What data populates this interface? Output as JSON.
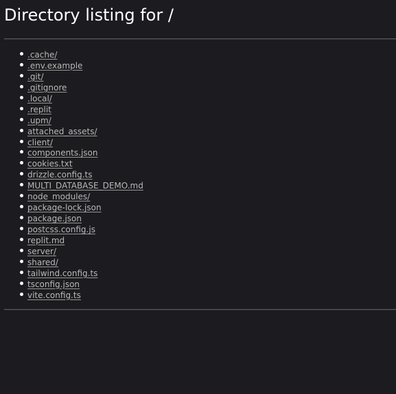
{
  "page": {
    "title": "Directory listing for /"
  },
  "entries": [
    ".cache/",
    ".env.example",
    ".git/",
    ".gitignore",
    ".local/",
    ".replit",
    ".upm/",
    "attached_assets/",
    "client/",
    "components.json",
    "cookies.txt",
    "drizzle.config.ts",
    "MULTI_DATABASE_DEMO.md",
    "node_modules/",
    "package-lock.json",
    "package.json",
    "postcss.config.js",
    "replit.md",
    "server/",
    "shared/",
    "tailwind.config.ts",
    "tsconfig.json",
    "vite.config.ts"
  ],
  "colors": {
    "background": "#1c1c20",
    "title": "#ffffff",
    "link": "#b8b8b8",
    "bullet": "#ffffff",
    "rule": "#5a5a5e"
  }
}
